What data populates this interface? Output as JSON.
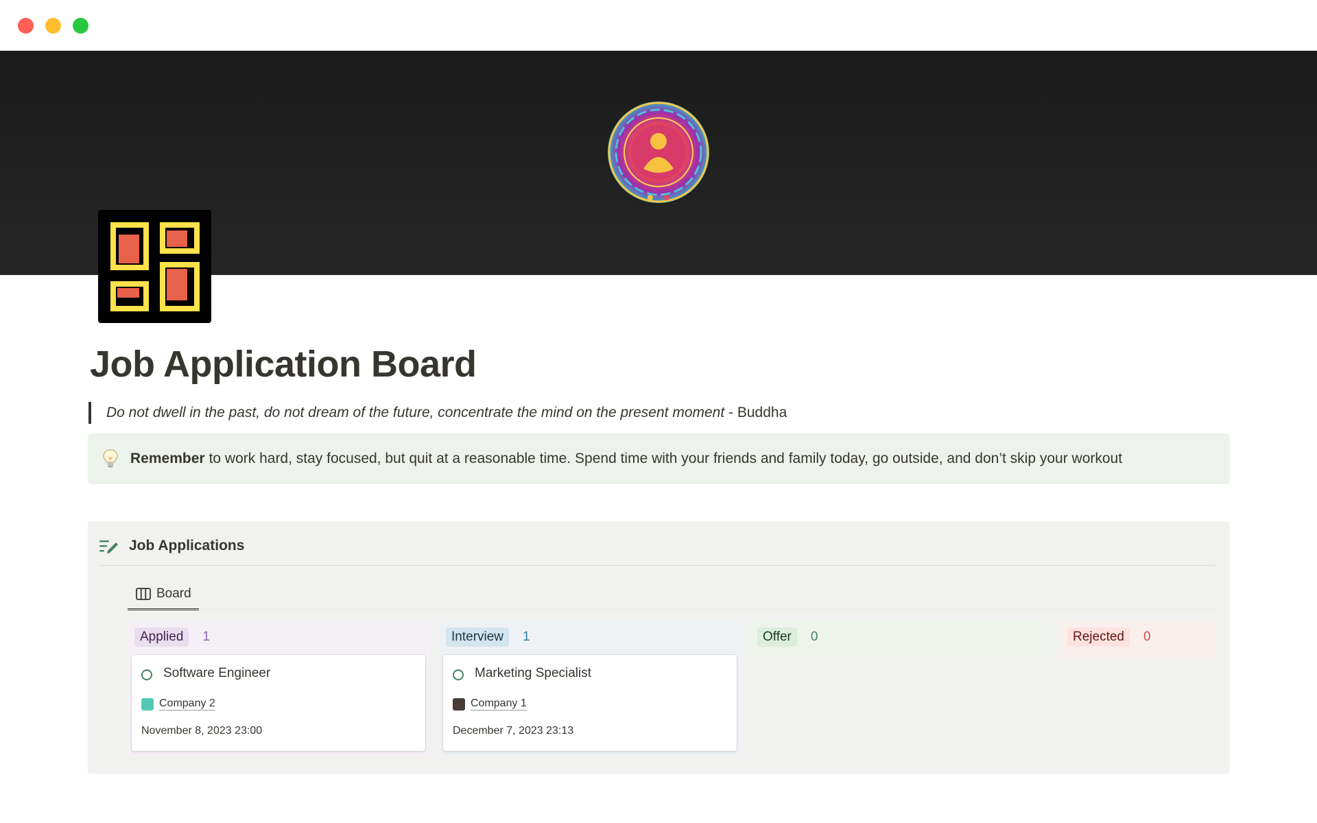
{
  "window": {
    "controls": [
      "close",
      "minimize",
      "maximize"
    ]
  },
  "page": {
    "title": "Job Application Board",
    "cover_icon": "meditation-mandala-illustration",
    "page_icon": "yellow-frames-grid-icon"
  },
  "quote": {
    "text": "Do not dwell in the past, do not dream of the future, concentrate the mind on the present moment",
    "attribution": " - Buddha"
  },
  "callout": {
    "icon": "lightbulb-icon",
    "bold": "Remember",
    "text": "to work hard, stay focused, but quit at a reasonable time. Spend time with your friends and family today, go outside, and don’t skip your workout"
  },
  "database": {
    "icon": "list-edit-icon",
    "title": "Job Applications",
    "view_tab": "Board",
    "columns": [
      {
        "label": "Applied",
        "count": "1",
        "cards": [
          {
            "title": "Software Engineer",
            "company": "Company 2",
            "date": "November 8, 2023 23:00"
          }
        ]
      },
      {
        "label": "Interview",
        "count": "1",
        "cards": [
          {
            "title": "Marketing Specialist",
            "company": "Company 1",
            "date": "December 7, 2023 23:13"
          }
        ]
      },
      {
        "label": "Offer",
        "count": "0",
        "cards": []
      },
      {
        "label": "Rejected",
        "count": "0",
        "cards": []
      }
    ]
  },
  "colors": {
    "cover": "#1f1f1f",
    "callout_bg": "#edf3ec",
    "database_bg": "#f1f1ef",
    "applied": "#9065b0",
    "interview": "#337ea9",
    "offer": "#448361",
    "rejected": "#d44c47"
  }
}
